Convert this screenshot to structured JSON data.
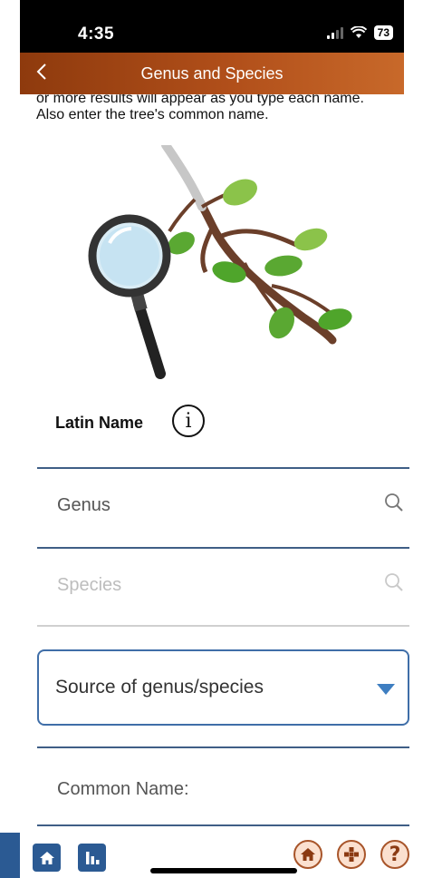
{
  "status": {
    "time": "4:35",
    "battery": "73"
  },
  "header": {
    "title": "Genus and Species"
  },
  "instructions": {
    "line1": "or more results will appear as you type each name.",
    "line2": "Also enter the tree's common name."
  },
  "latin": {
    "label": "Latin Name",
    "info_glyph": "i"
  },
  "fields": {
    "genus_placeholder": "Genus",
    "species_placeholder": "Species",
    "source_label": "Source of genus/species",
    "common_placeholder": "Common Name:"
  },
  "help": {
    "glyph": "?"
  },
  "colors": {
    "header_start": "#8e3a0d",
    "header_end": "#c8692a",
    "field_line": "#3f5e86",
    "nav_blue": "#2b5a93",
    "accent_brown": "#8b3a12",
    "dropdown_arrow": "#3e7ec1"
  },
  "icons": {
    "back": "chevron-left-icon",
    "search": "search-icon",
    "dropdown": "caret-down-icon",
    "info": "info-icon",
    "home": "home-icon",
    "stats": "bar-chart-icon",
    "grid": "grid-icon",
    "help": "question-icon"
  }
}
